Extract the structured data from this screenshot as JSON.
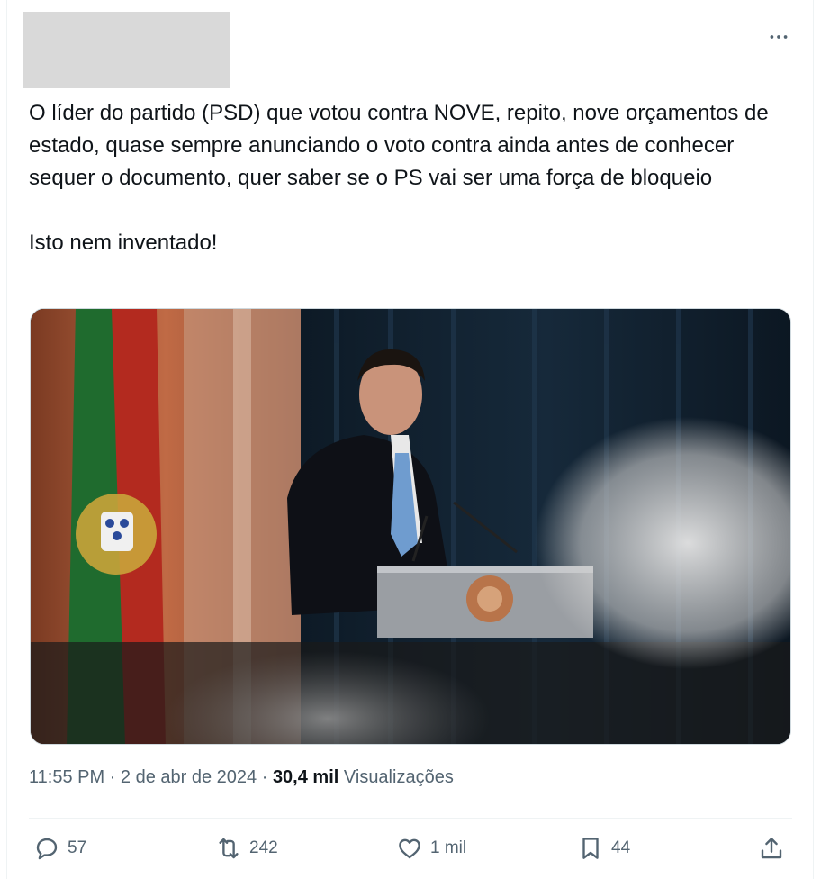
{
  "tweet": {
    "paragraphs": [
      "O líder do partido (PSD) que votou contra NOVE, repito, nove orçamentos de estado, quase sempre anunciando o voto contra ainda antes de conhecer sequer o documento, quer saber se o PS vai ser uma força de bloqueio",
      "Isto nem inventado!"
    ],
    "more_icon": "ellipsis-icon",
    "media_alt": "photo"
  },
  "meta": {
    "time": "11:55 PM",
    "sep1": " · ",
    "date": "2 de abr de 2024",
    "sep2": " · ",
    "views_count": "30,4 mil",
    "views_label": "Visualizações"
  },
  "actions": {
    "reply": {
      "icon": "reply-icon",
      "count": "57"
    },
    "repost": {
      "icon": "repost-icon",
      "count": "242"
    },
    "like": {
      "icon": "heart-icon",
      "count": "1 mil"
    },
    "bookmark": {
      "icon": "bookmark-icon",
      "count": "44"
    },
    "share": {
      "icon": "share-icon"
    }
  },
  "colors": {
    "text": "#0f1419",
    "secondary": "#536471",
    "border": "#cfd9de"
  }
}
